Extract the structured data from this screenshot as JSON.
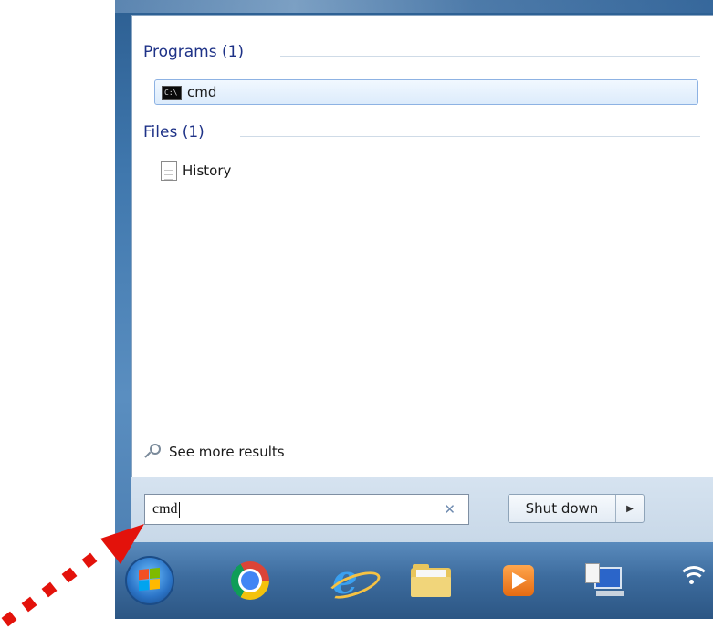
{
  "start_menu": {
    "programs": {
      "heading": "Programs (1)",
      "items": [
        {
          "label": "cmd",
          "icon": "command-prompt-icon",
          "selected": true
        }
      ]
    },
    "files": {
      "heading": "Files (1)",
      "items": [
        {
          "label": "History",
          "icon": "text-document-icon"
        }
      ]
    },
    "see_more": {
      "label": "See more results",
      "icon": "search-icon"
    },
    "search": {
      "value": "cmd",
      "clear_icon": "clear-x-icon"
    },
    "shutdown": {
      "label": "Shut down",
      "arrow_icon": "triangle-right-icon"
    }
  },
  "taskbar": {
    "items": [
      {
        "name": "start-orb",
        "icon": "windows-start-icon"
      },
      {
        "name": "chrome",
        "icon": "chrome-icon"
      },
      {
        "name": "internet-explorer",
        "icon": "internet-explorer-icon"
      },
      {
        "name": "file-explorer",
        "icon": "folder-icon"
      },
      {
        "name": "media-player",
        "icon": "media-player-icon"
      },
      {
        "name": "remote-desktop",
        "icon": "computer-icon"
      },
      {
        "name": "network",
        "icon": "wifi-icon"
      }
    ]
  },
  "annotation": {
    "icon": "red-dotted-arrow-icon",
    "color": "#e3120b"
  },
  "colors": {
    "heading": "#1e3287",
    "selection_border": "#8db2e3",
    "taskbar": "#3d6c9e"
  }
}
